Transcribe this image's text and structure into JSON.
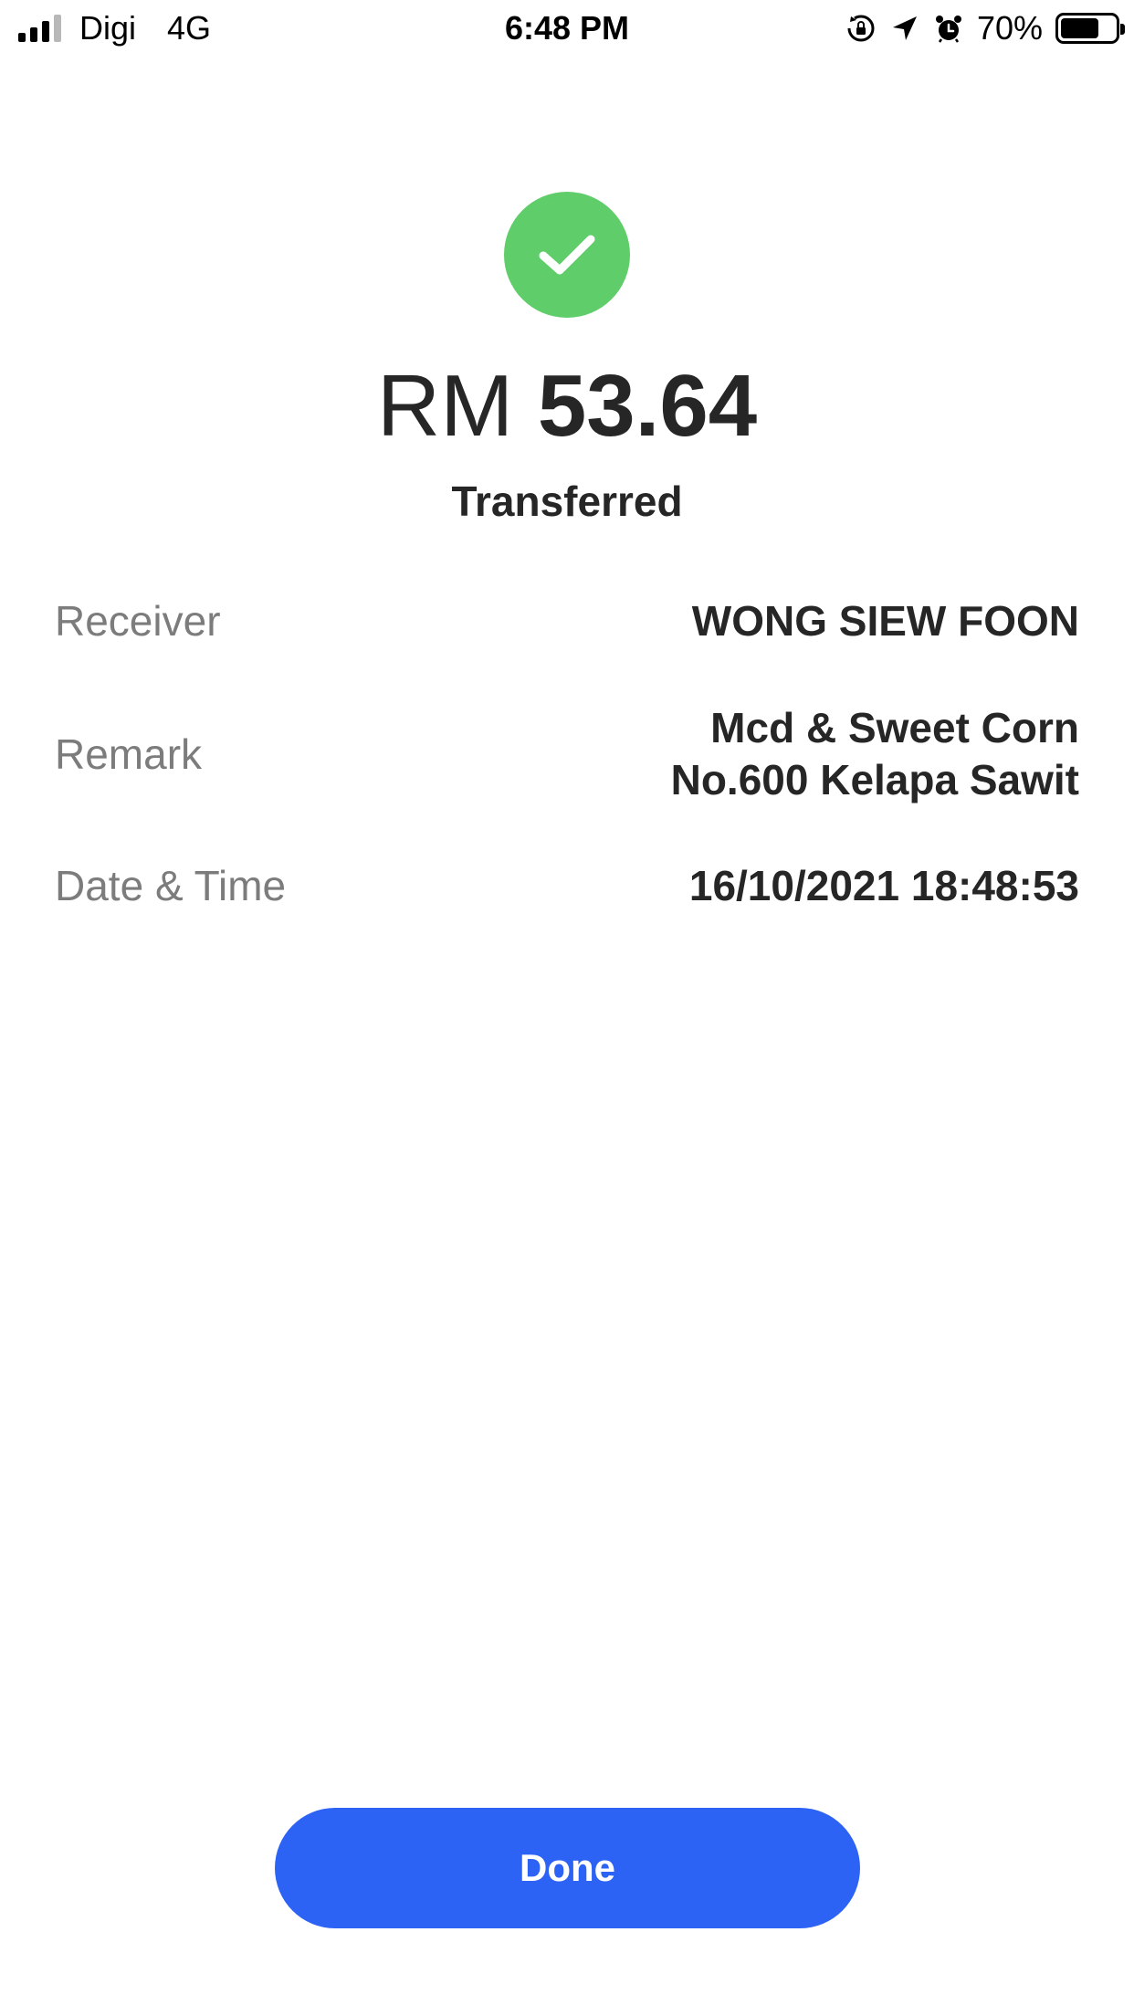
{
  "status_bar": {
    "carrier": "Digi",
    "network": "4G",
    "time": "6:48 PM",
    "battery_percent_label": "70%",
    "battery_level": 0.7,
    "signal_bars": 3,
    "icons": [
      "signal-icon",
      "orientation-lock-icon",
      "location-arrow-icon",
      "alarm-icon",
      "battery-icon"
    ]
  },
  "transaction": {
    "icon": "checkmark-icon",
    "currency": "RM",
    "amount": "53.64",
    "status": "Transferred",
    "details": {
      "receiver_label": "Receiver",
      "receiver_value": "WONG SIEW FOON",
      "remark_label": "Remark",
      "remark_line1": "Mcd & Sweet Corn",
      "remark_line2": "No.600 Kelapa Sawit",
      "datetime_label": "Date & Time",
      "datetime_value": "16/10/2021 18:48:53"
    }
  },
  "actions": {
    "done_label": "Done"
  },
  "colors": {
    "success": "#5fcd6a",
    "primary": "#2d63f5",
    "label_gray": "#7c7c7c",
    "text_dark": "#262626"
  }
}
